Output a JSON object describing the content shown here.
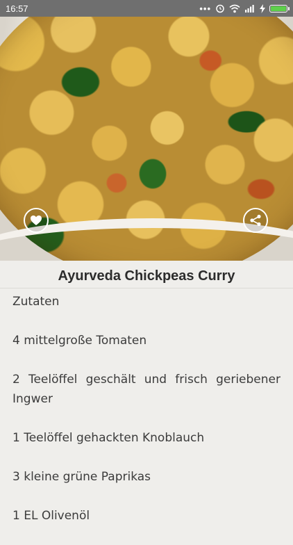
{
  "status_bar": {
    "time": "16:57",
    "icons": [
      "more-dots-icon",
      "alarm-icon",
      "wifi-icon",
      "signal-icon",
      "charging-icon",
      "battery-icon"
    ],
    "battery_color": "#5ed04b"
  },
  "recipe": {
    "title": "Ayurveda Chickpeas Curry",
    "lines": [
      "Zutaten",
      "4 mittelgroße Tomaten",
      "2 Teelöffel geschält und frisch geriebener Ingwer",
      "1 Teelöffel gehackten Knoblauch",
      "3 kleine grüne Paprikas",
      "1 EL Olivenöl"
    ]
  },
  "actions": {
    "favorite_icon": "heart-icon",
    "share_icon": "share-icon"
  }
}
